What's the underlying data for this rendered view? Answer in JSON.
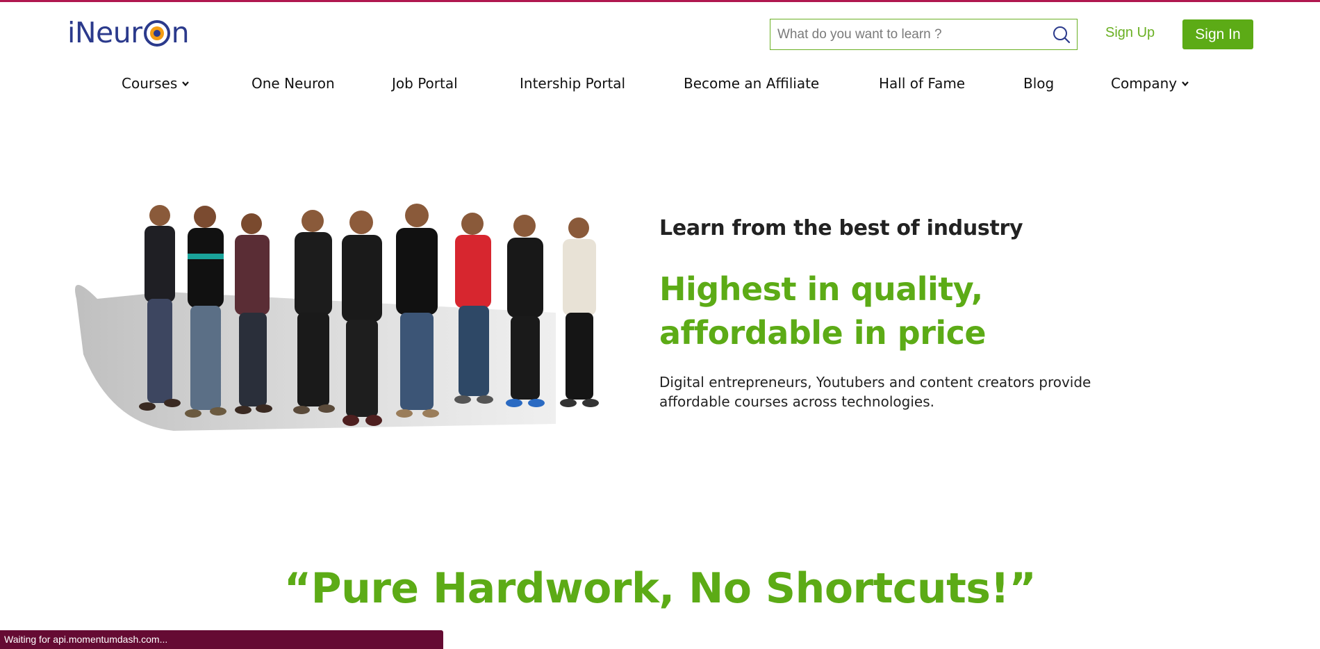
{
  "brand": {
    "logo_prefix": "iNeur",
    "logo_suffix": "n",
    "logo_color": "#2b3a8c",
    "logo_accent": "#f39c12"
  },
  "header": {
    "search": {
      "placeholder": "What do you want to learn ?",
      "value": "",
      "icon": "search-icon"
    },
    "signup_label": "Sign Up",
    "signin_label": "Sign In",
    "accent_color": "#5cab16"
  },
  "nav": {
    "items": [
      {
        "label": "Courses",
        "has_dropdown": true
      },
      {
        "label": "One Neuron",
        "has_dropdown": false
      },
      {
        "label": "Job Portal",
        "has_dropdown": false
      },
      {
        "label": "Intership Portal",
        "has_dropdown": false
      },
      {
        "label": "Become an Affiliate",
        "has_dropdown": false
      },
      {
        "label": "Hall of Fame",
        "has_dropdown": false
      },
      {
        "label": "Blog",
        "has_dropdown": false
      },
      {
        "label": "Company",
        "has_dropdown": true
      }
    ]
  },
  "hero": {
    "image": "team-photo",
    "tagline": "Learn from the best of industry",
    "title": "Highest in quality, affordable in price",
    "description": "Digital entrepreneurs, Youtubers and content creators provide affordable courses across technologies."
  },
  "quote": "“Pure Hardwork, No Shortcuts!”",
  "status_bar": {
    "text": "Waiting for api.momentumdash.com..."
  }
}
